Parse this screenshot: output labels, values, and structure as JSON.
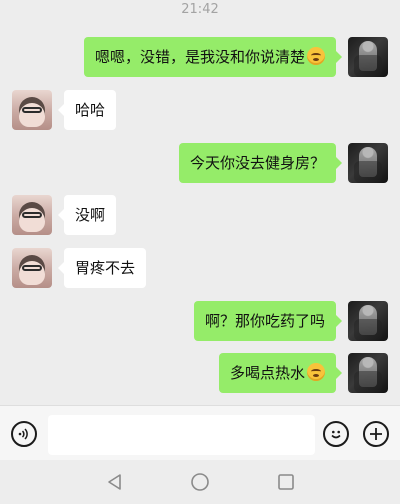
{
  "status": {
    "time": "21:42"
  },
  "messages": [
    {
      "from": "me",
      "text": "嗯嗯，没错，是我没和你说清楚",
      "emoji": "awkward-smile-emoji"
    },
    {
      "from": "them",
      "text": "哈哈"
    },
    {
      "from": "me",
      "text": "今天你没去健身房？"
    },
    {
      "from": "them",
      "text": "没啊"
    },
    {
      "from": "them",
      "text": "胃疼不去"
    },
    {
      "from": "me",
      "text": "啊？那你吃药了吗"
    },
    {
      "from": "me",
      "text": "多喝点热水",
      "emoji": "awkward-smile-emoji"
    }
  ],
  "input_bar": {
    "voice_icon": "voice-icon",
    "message_value": "",
    "emoji_icon": "emoji-icon",
    "plus_icon": "plus-icon"
  },
  "nav_bar": {
    "icons": [
      "back-triangle-icon",
      "home-circle-icon",
      "recents-square-icon"
    ]
  }
}
